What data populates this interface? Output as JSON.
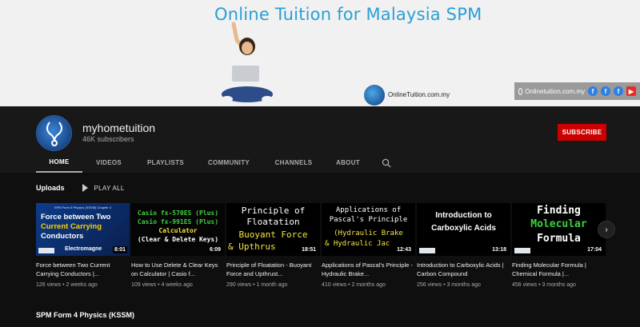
{
  "banner": {
    "title": "Online Tuition for Malaysia SPM",
    "site_text": "OnlineTuition.com.my",
    "links_text": "Onlinetuition.com.my",
    "social_icons": [
      "facebook-icon",
      "facebook-icon",
      "facebook-icon",
      "youtube-icon"
    ]
  },
  "channel": {
    "name": "myhometuition",
    "subscribers": "46K subscribers",
    "subscribe_label": "SUBSCRIBE"
  },
  "tabs": [
    "HOME",
    "VIDEOS",
    "PLAYLISTS",
    "COMMUNITY",
    "CHANNELS",
    "ABOUT"
  ],
  "active_tab": "HOME",
  "uploads": {
    "title": "Uploads",
    "play_all": "PLAY ALL"
  },
  "videos": [
    {
      "thumb_lines": [
        "SPM Form 5 Physics (KSSM) Chapter 4",
        "Force between Two",
        "Current Carrying",
        "Conductors",
        "Electromagne"
      ],
      "duration": "8:01",
      "title": "Force between Two Current Carrying Conductors |...",
      "meta": "126 views • 2 weeks ago"
    },
    {
      "thumb_lines": [
        "Casio fx-570ES (Plus)",
        "Casio fx-991ES (Plus)",
        "Calculator",
        "(Clear & Delete Keys)"
      ],
      "duration": "6:09",
      "title": "How to Use Delete & Clear Keys on Calculator | Casio f...",
      "meta": "109 views • 4 weeks ago"
    },
    {
      "thumb_lines": [
        "Principle of",
        "Floatation",
        "Buoyant Force",
        "& Upthrus"
      ],
      "duration": "18:51",
      "title": "Principle of Floatation - Buoyant Force and Upthrust...",
      "meta": "290 views • 1 month ago"
    },
    {
      "thumb_lines": [
        "Applications of",
        "Pascal's Principle",
        "(Hydraulic Brake",
        "& Hydraulic Jac"
      ],
      "duration": "12:43",
      "title": "Applications of Pascal's Principle - Hydraulic Brake...",
      "meta": "410 views • 2 months ago"
    },
    {
      "thumb_lines": [
        "Introduction to",
        "Carboxylic Acids"
      ],
      "duration": "13:18",
      "title": "Introduction to Carboxylic Acids | Carbon Compound",
      "meta": "256 views • 3 months ago"
    },
    {
      "thumb_lines": [
        "Finding",
        "Molecular",
        "Formula"
      ],
      "duration": "17:04",
      "title": "Finding Molecular Formula | Chemical Formula |...",
      "meta": "456 views • 3 months ago"
    }
  ],
  "next_icon": "chevron-right-icon",
  "section2_title": "SPM Form 4 Physics (KSSM)",
  "colors": {
    "accent_blue": "#2a9fd6",
    "subscribe_red": "#cc0000",
    "thumb_green": "#3fd13f",
    "thumb_yellow": "#f5e642"
  }
}
